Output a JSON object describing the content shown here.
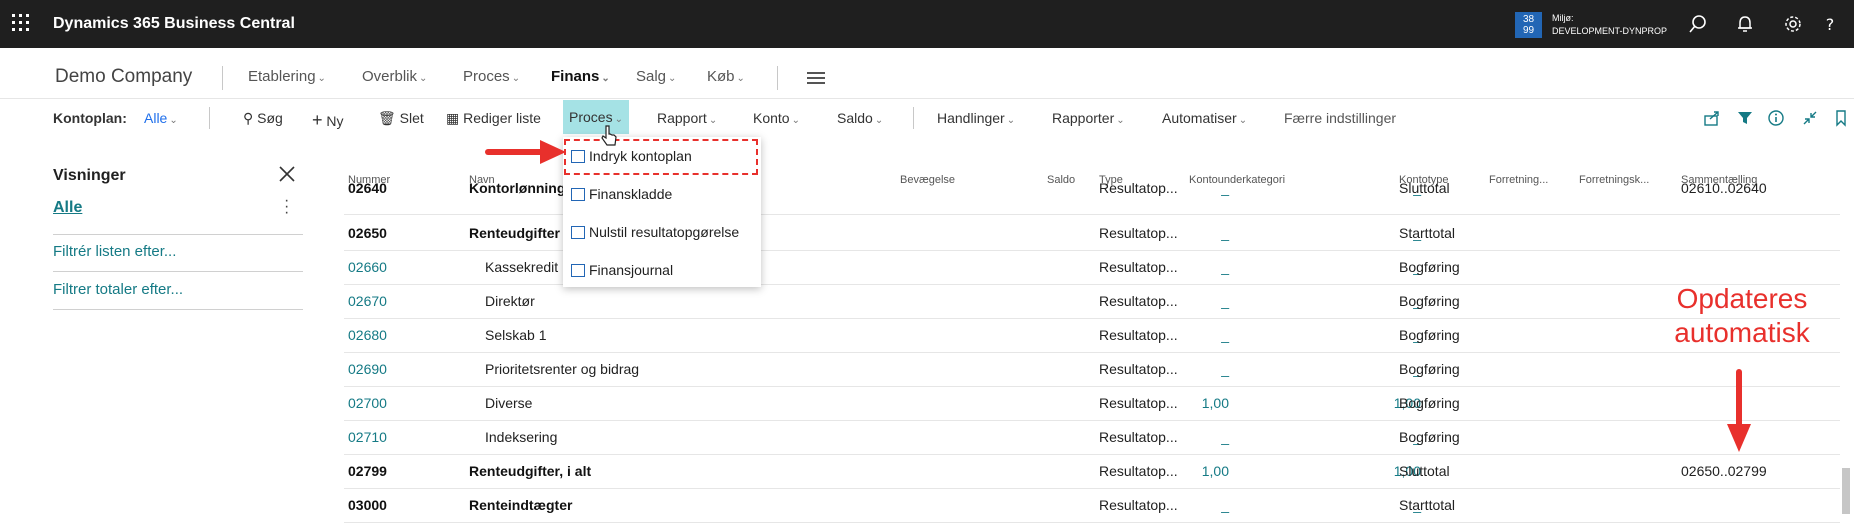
{
  "app": {
    "title": "Dynamics 365 Business Central"
  },
  "environment": {
    "badge_top": "38",
    "badge_bottom": "99",
    "label": "Miljø:",
    "name": "DEVELOPMENT-DYNPROP"
  },
  "top_icons": [
    "search-icon",
    "bell-icon",
    "gear-icon",
    "help-icon"
  ],
  "company": "Demo Company",
  "nav": [
    {
      "label": "Etablering"
    },
    {
      "label": "Overblik"
    },
    {
      "label": "Proces"
    },
    {
      "label": "Finans",
      "active": true
    },
    {
      "label": "Salg"
    },
    {
      "label": "Køb"
    }
  ],
  "actionbar": {
    "kontoplan_label": "Kontoplan:",
    "kontoplan_value": "Alle",
    "sog": "Søg",
    "ny": "Ny",
    "slet": "Slet",
    "rediger": "Rediger liste",
    "proces": "Proces",
    "rapport": "Rapport",
    "konto": "Konto",
    "saldo": "Saldo",
    "handlinger": "Handlinger",
    "rapporter": "Rapporter",
    "automatiser": "Automatiser",
    "faerre": "Færre indstillinger"
  },
  "pane": {
    "title": "Visninger",
    "all": "Alle",
    "filter_list": "Filtrér listen efter...",
    "filter_totals": "Filtrer totaler efter..."
  },
  "columns": [
    "Nummer",
    "Navn",
    "Bevægelse",
    "Saldo",
    "Type",
    "Kontounderkategori",
    "Kontotype",
    "Forretning...",
    "Forretningsk...",
    "Sammentælling"
  ],
  "rows": [
    {
      "nummer": "02640",
      "navn": "Kontorlønning",
      "bev": "_",
      "saldo": "_",
      "type": "Resultatop...",
      "kontotype": "Sluttotal",
      "sum": "02610..02640",
      "bold": true
    },
    {
      "nummer": "02650",
      "navn": "Renteudgifter",
      "bev": "_",
      "saldo": "_",
      "type": "Resultatop...",
      "kontotype": "Starttotal",
      "sum": "",
      "bold": true
    },
    {
      "nummer": "02660",
      "navn": "Kassekredit",
      "bev": "_",
      "saldo": "_",
      "type": "Resultatop...",
      "kontotype": "Bogføring",
      "sum": "",
      "bold": false
    },
    {
      "nummer": "02670",
      "navn": "Direktør",
      "bev": "_",
      "saldo": "_",
      "type": "Resultatop...",
      "kontotype": "Bogføring",
      "sum": "",
      "bold": false
    },
    {
      "nummer": "02680",
      "navn": "Selskab 1",
      "bev": "_",
      "saldo": "_",
      "type": "Resultatop...",
      "kontotype": "Bogføring",
      "sum": "",
      "bold": false
    },
    {
      "nummer": "02690",
      "navn": "Prioritetsrenter og bidrag",
      "bev": "_",
      "saldo": "_",
      "type": "Resultatop...",
      "kontotype": "Bogføring",
      "sum": "",
      "bold": false
    },
    {
      "nummer": "02700",
      "navn": "Diverse",
      "bev": "1,00",
      "saldo": "1,00",
      "type": "Resultatop...",
      "kontotype": "Bogføring",
      "sum": "",
      "bold": false
    },
    {
      "nummer": "02710",
      "navn": "Indeksering",
      "bev": "_",
      "saldo": "_",
      "type": "Resultatop...",
      "kontotype": "Bogføring",
      "sum": "",
      "bold": false
    },
    {
      "nummer": "02799",
      "navn": "Renteudgifter, i alt",
      "bev": "1,00",
      "saldo": "1,00",
      "type": "Resultatop...",
      "kontotype": "Sluttotal",
      "sum": "02650..02799",
      "bold": true
    },
    {
      "nummer": "03000",
      "navn": "Renteindtægter",
      "bev": "_",
      "saldo": "_",
      "type": "Resultatop...",
      "kontotype": "Starttotal",
      "sum": "",
      "bold": true
    }
  ],
  "dropdown": [
    "Indryk kontoplan",
    "Finanskladde",
    "Nulstil resultatopgørelse",
    "Finansjournal"
  ],
  "annotation": {
    "line1": "Opdateres",
    "line2": "automatisk"
  },
  "colors": {
    "accent": "#157a85",
    "highlight": "#a5e2e5",
    "annotation": "#e8302c",
    "topbar": "#1f1f1f"
  }
}
